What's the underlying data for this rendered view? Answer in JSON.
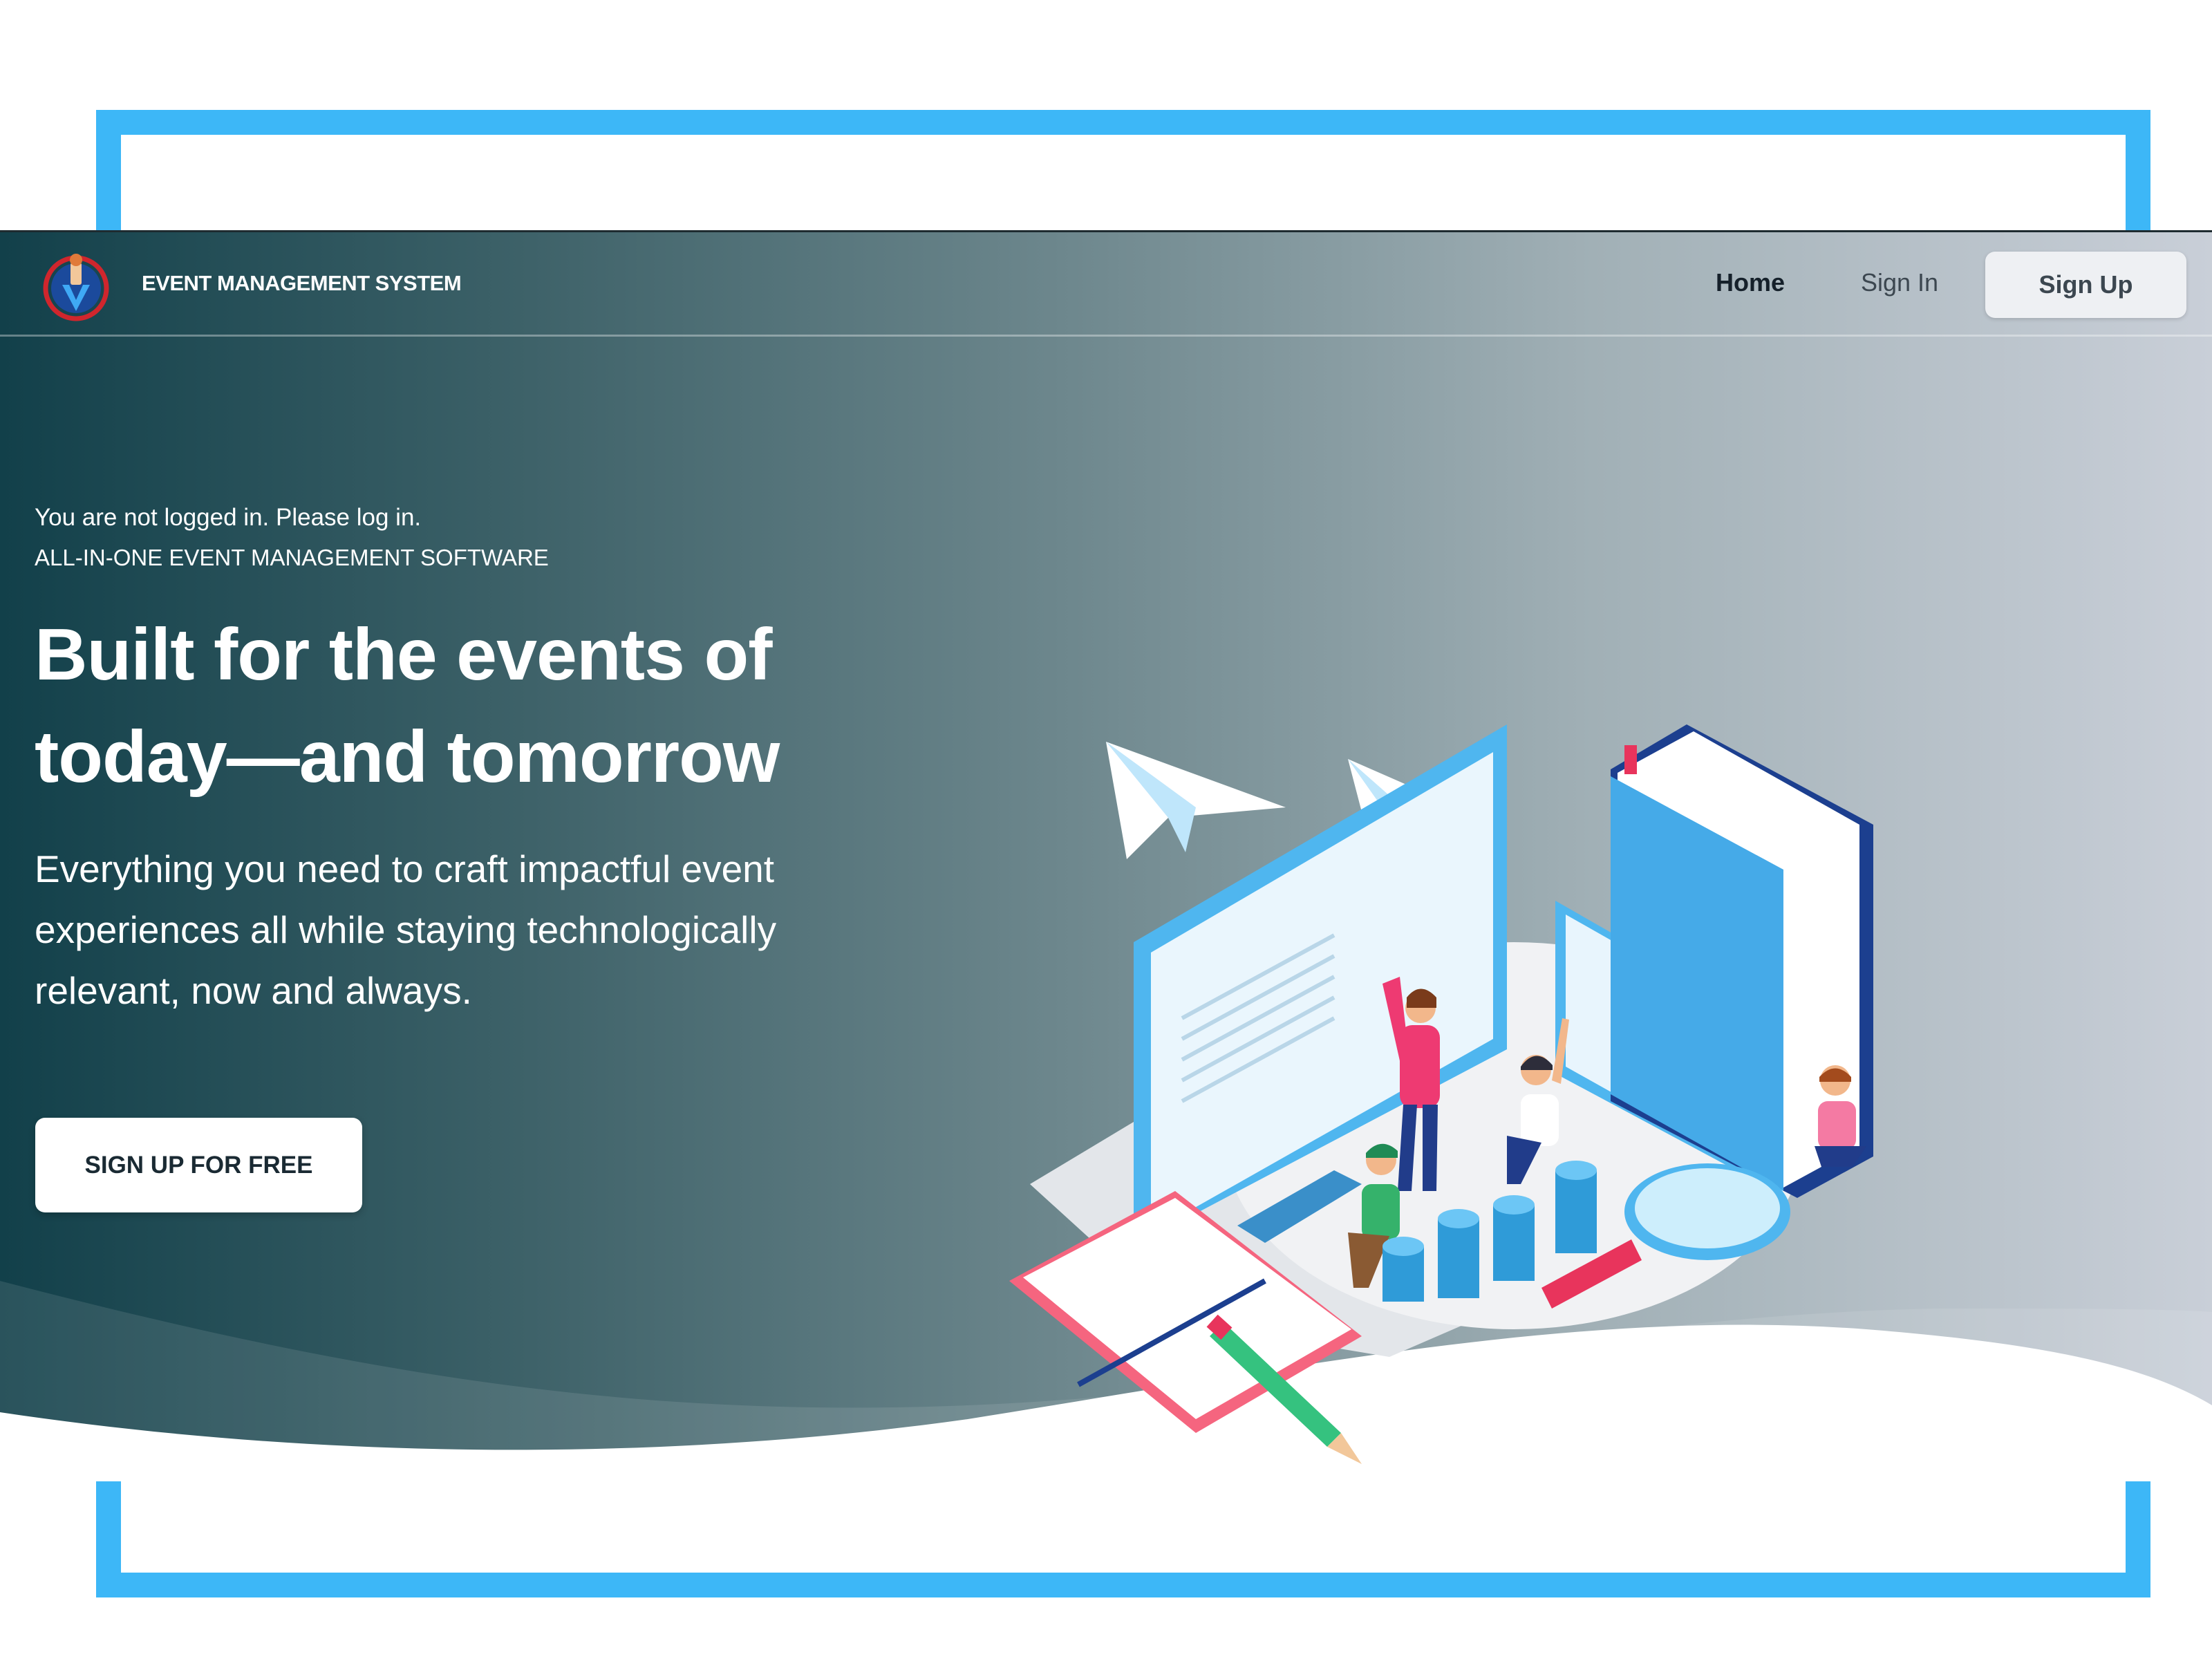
{
  "header": {
    "brand_name": "EVENT MANAGEMENT SYSTEM",
    "logo_icon": "event-logo-icon",
    "nav": {
      "home": "Home",
      "sign_in": "Sign In",
      "sign_up": "Sign Up"
    }
  },
  "hero": {
    "status": "You are not logged in. Please log in.",
    "tagline": "ALL-IN-ONE EVENT MANAGEMENT SOFTWARE",
    "title_line1": "Built for the events of",
    "title_line2": "today—and tomorrow",
    "subtitle_line1": "Everything you need to craft impactful event",
    "subtitle_line2": "experiences all while staying technologically",
    "subtitle_line3": "relevant, now and always.",
    "cta_label": "SIGN UP FOR FREE"
  },
  "colors": {
    "frame": "#3db7f7",
    "gradient_start": "#12404a",
    "gradient_end": "#c9cfd8",
    "cta_bg": "#ffffff",
    "signup_bg": "#eef0f3"
  },
  "illustration": {
    "icon": "isometric-team-workspace-illustration"
  }
}
